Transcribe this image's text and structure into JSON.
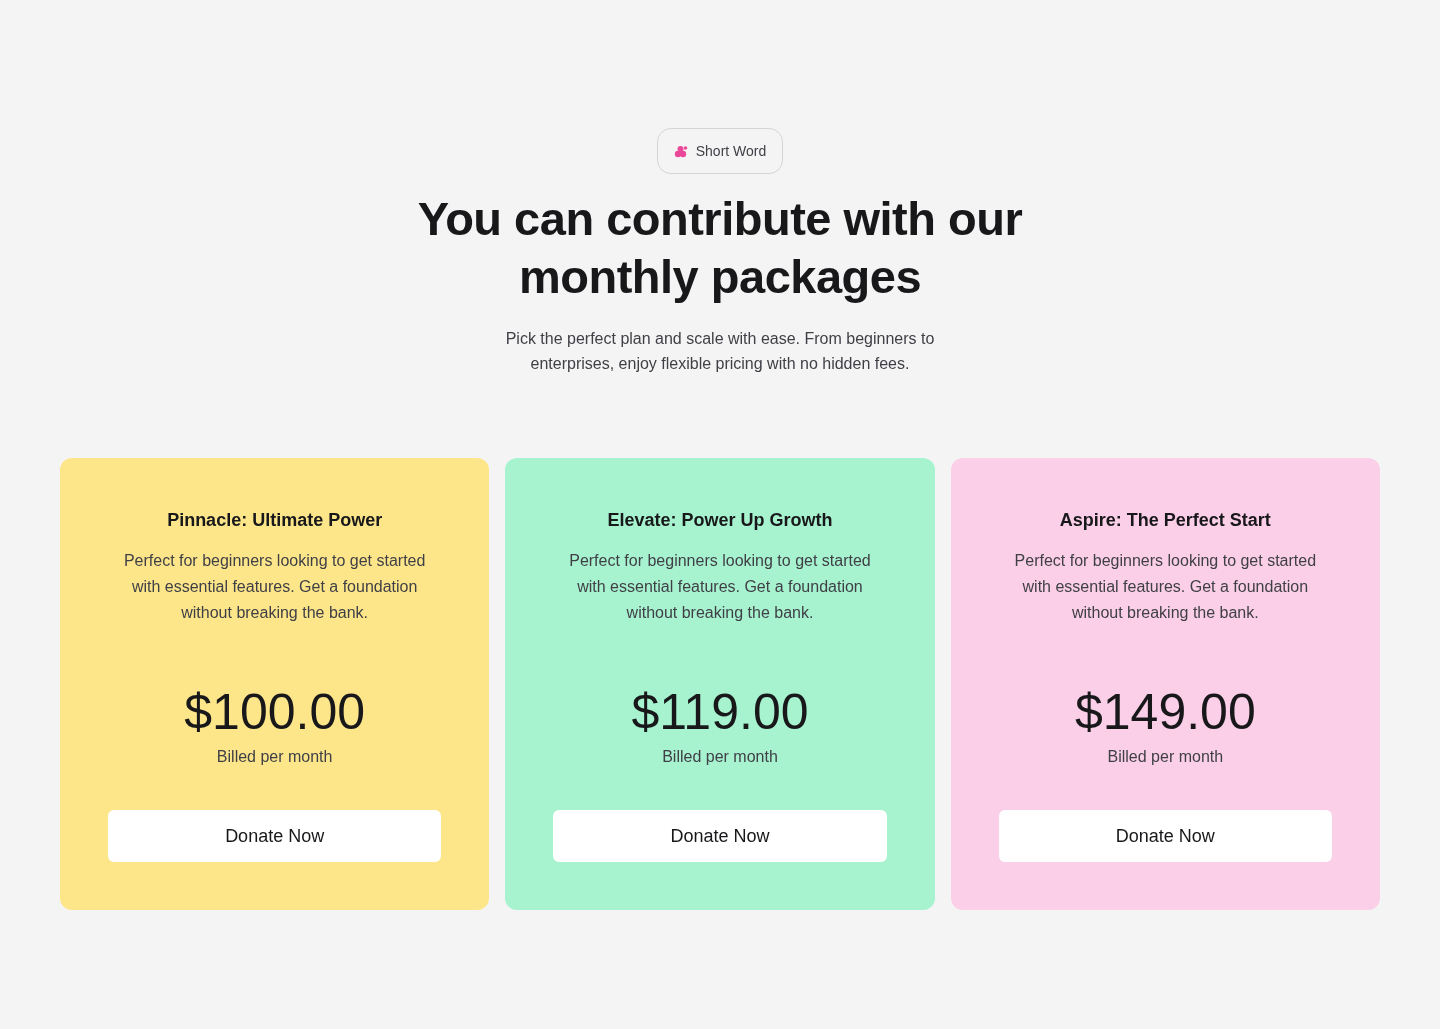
{
  "badge": {
    "label": "Short Word"
  },
  "heading": "You can contribute with our monthly packages",
  "subtitle": "Pick the perfect plan and scale with ease. From beginners to enterprises, enjoy flexible pricing with no hidden fees.",
  "plans": [
    {
      "title": "Pinnacle: Ultimate Power",
      "description": "Perfect for beginners looking to get started with essential features. Get a foundation without breaking the bank.",
      "price": "$100.00",
      "billing": "Billed per month",
      "button": "Donate Now",
      "color": "#fde68a"
    },
    {
      "title": "Elevate: Power Up Growth",
      "description": "Perfect for beginners looking to get started with essential features. Get a foundation without breaking the bank.",
      "price": "$119.00",
      "billing": "Billed per month",
      "button": "Donate Now",
      "color": "#a7f3d0"
    },
    {
      "title": "Aspire: The Perfect Start",
      "description": "Perfect for beginners looking to get started with essential features. Get a foundation without breaking the bank.",
      "price": "$149.00",
      "billing": "Billed per month",
      "button": "Donate Now",
      "color": "#fbcfe8"
    }
  ]
}
